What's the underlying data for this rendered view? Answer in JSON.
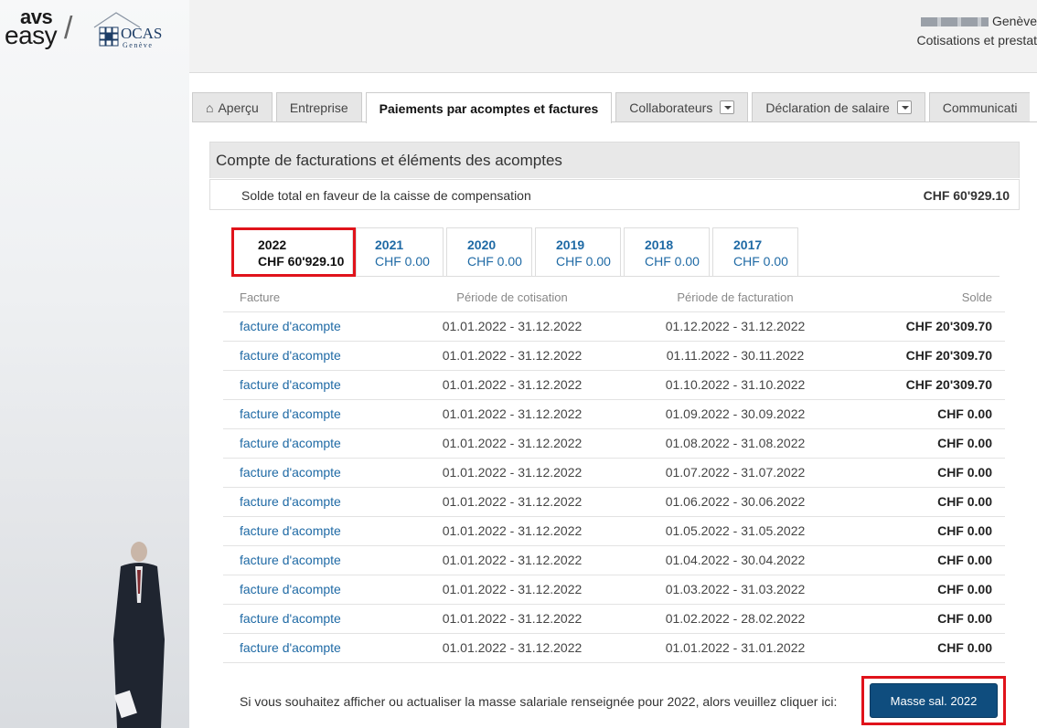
{
  "logo": {
    "avs": "avs",
    "easy": "easy",
    "slash": "/",
    "ocas": "OCAS",
    "ocas_sub": "Genève"
  },
  "header": {
    "user_location": "Genève",
    "user_context": "Cotisations et prestat"
  },
  "tabs": [
    {
      "label": "Aperçu",
      "icon": "home-icon"
    },
    {
      "label": "Entreprise"
    },
    {
      "label": "Paiements par acomptes et factures",
      "active": true
    },
    {
      "label": "Collaborateurs",
      "dropdown": true
    },
    {
      "label": "Déclaration de salaire",
      "dropdown": true
    },
    {
      "label": "Communicati"
    }
  ],
  "panel": {
    "title": "Compte de facturations et éléments des acomptes",
    "solde_label": "Solde total en faveur de la caisse de compensation",
    "solde_amount": "CHF 60'929.10"
  },
  "years": [
    {
      "year": "2022",
      "amount": "CHF 60'929.10",
      "active": true
    },
    {
      "year": "2021",
      "amount": "CHF 0.00"
    },
    {
      "year": "2020",
      "amount": "CHF 0.00"
    },
    {
      "year": "2019",
      "amount": "CHF 0.00"
    },
    {
      "year": "2018",
      "amount": "CHF 0.00"
    },
    {
      "year": "2017",
      "amount": "CHF 0.00"
    }
  ],
  "table": {
    "headers": [
      "Facture",
      "Période de cotisation",
      "Période de facturation",
      "Solde"
    ],
    "rows": [
      [
        "facture d'acompte",
        "01.01.2022 - 31.12.2022",
        "01.12.2022 - 31.12.2022",
        "CHF 20'309.70"
      ],
      [
        "facture d'acompte",
        "01.01.2022 - 31.12.2022",
        "01.11.2022 - 30.11.2022",
        "CHF 20'309.70"
      ],
      [
        "facture d'acompte",
        "01.01.2022 - 31.12.2022",
        "01.10.2022 - 31.10.2022",
        "CHF 20'309.70"
      ],
      [
        "facture d'acompte",
        "01.01.2022 - 31.12.2022",
        "01.09.2022 - 30.09.2022",
        "CHF 0.00"
      ],
      [
        "facture d'acompte",
        "01.01.2022 - 31.12.2022",
        "01.08.2022 - 31.08.2022",
        "CHF 0.00"
      ],
      [
        "facture d'acompte",
        "01.01.2022 - 31.12.2022",
        "01.07.2022 - 31.07.2022",
        "CHF 0.00"
      ],
      [
        "facture d'acompte",
        "01.01.2022 - 31.12.2022",
        "01.06.2022 - 30.06.2022",
        "CHF 0.00"
      ],
      [
        "facture d'acompte",
        "01.01.2022 - 31.12.2022",
        "01.05.2022 - 31.05.2022",
        "CHF 0.00"
      ],
      [
        "facture d'acompte",
        "01.01.2022 - 31.12.2022",
        "01.04.2022 - 30.04.2022",
        "CHF 0.00"
      ],
      [
        "facture d'acompte",
        "01.01.2022 - 31.12.2022",
        "01.03.2022 - 31.03.2022",
        "CHF 0.00"
      ],
      [
        "facture d'acompte",
        "01.01.2022 - 31.12.2022",
        "01.02.2022 - 28.02.2022",
        "CHF 0.00"
      ],
      [
        "facture d'acompte",
        "01.01.2022 - 31.12.2022",
        "01.01.2022 - 31.01.2022",
        "CHF 0.00"
      ]
    ]
  },
  "footer": {
    "text": "Si vous souhaitez afficher ou actualiser la masse salariale renseignée pour 2022, alors veuillez cliquer ici:",
    "button_label": "Masse sal. 2022"
  },
  "colors": {
    "link": "#1f6aa5",
    "primary_button": "#0f4d7e",
    "highlight": "#e0131b"
  }
}
